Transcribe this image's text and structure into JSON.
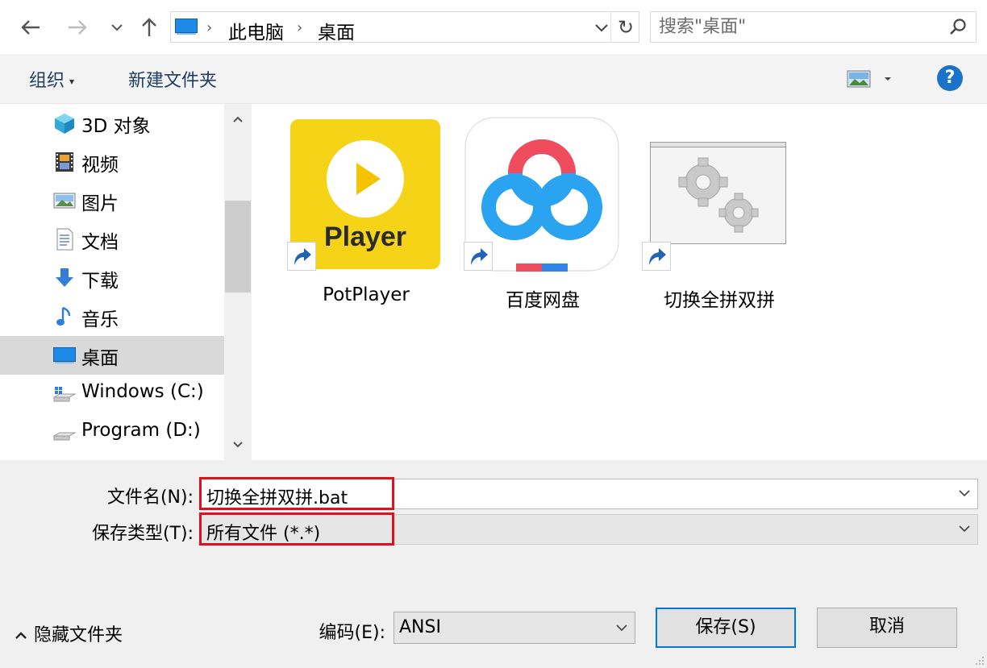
{
  "address_bar": {
    "crumbs": [
      "此电脑",
      "桌面"
    ],
    "search_placeholder": "搜索\"桌面\""
  },
  "command_bar": {
    "organize_label": "组织",
    "new_folder_label": "新建文件夹",
    "help_label": "?"
  },
  "nav_pane": {
    "items": [
      {
        "label": "3D 对象",
        "icon": "3d-objects-icon"
      },
      {
        "label": "视频",
        "icon": "video-icon"
      },
      {
        "label": "图片",
        "icon": "pictures-icon"
      },
      {
        "label": "文档",
        "icon": "documents-icon"
      },
      {
        "label": "下载",
        "icon": "downloads-icon"
      },
      {
        "label": "音乐",
        "icon": "music-icon"
      },
      {
        "label": "桌面",
        "icon": "desktop-icon",
        "selected": true
      },
      {
        "label": "Windows (C:)",
        "icon": "windows-drive-icon"
      },
      {
        "label": "Program (D:)",
        "icon": "drive-icon"
      }
    ]
  },
  "files": [
    {
      "name": "PotPlayer",
      "thumb_text": "Player",
      "icon": "potplayer-icon",
      "color": "#f5d316"
    },
    {
      "name": "百度网盘",
      "icon": "baidu-netdisk-icon"
    },
    {
      "name": "切换全拼双拼",
      "icon": "batch-file-gears-icon"
    }
  ],
  "form": {
    "filename_label": "文件名(N):",
    "filename_value": "切换全拼双拼.bat",
    "filetype_label": "保存类型(T):",
    "filetype_value": "所有文件  (*.*)",
    "encoding_label": "编码(E):",
    "encoding_value": "ANSI",
    "hide_folders_label": "隐藏文件夹",
    "save_label": "保存(S)",
    "cancel_label": "取消"
  },
  "colors": {
    "accent": "#0078d7",
    "highlight_box": "#e0101e",
    "help_button": "#1a73c9"
  }
}
